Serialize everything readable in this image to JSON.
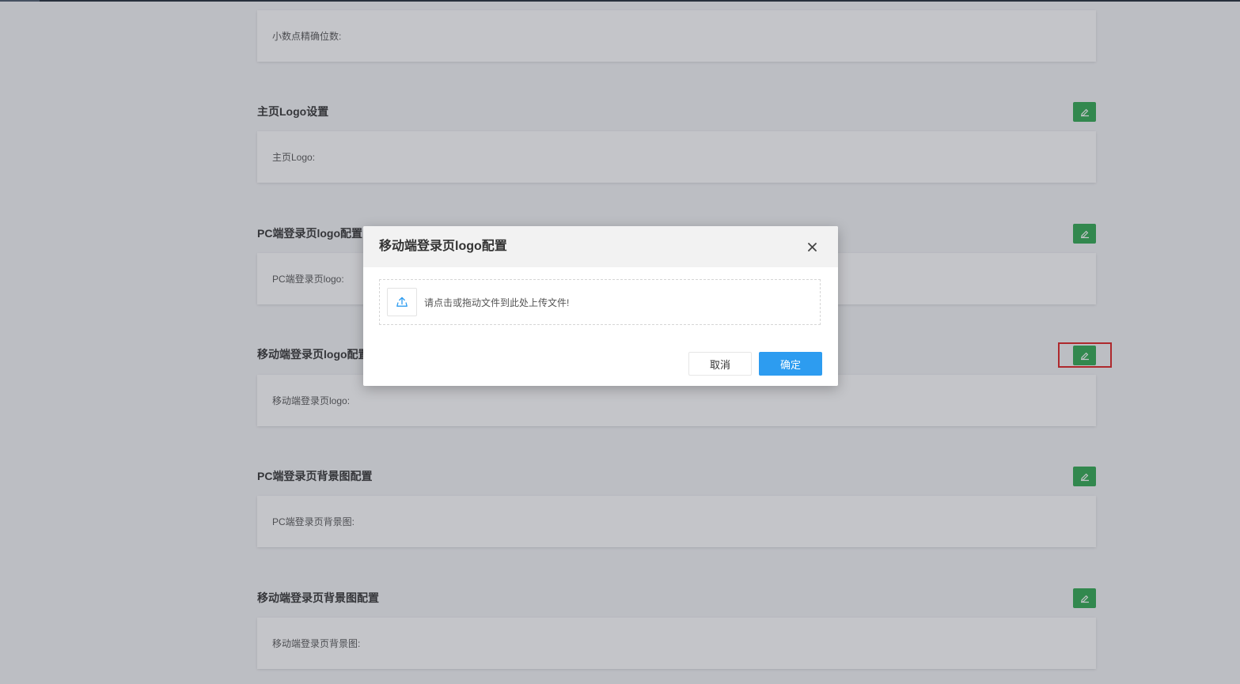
{
  "sections": [
    {
      "title": "",
      "field_label": "小数点精确位数:"
    },
    {
      "title": "主页Logo设置",
      "field_label": "主页Logo:"
    },
    {
      "title": "PC端登录页logo配置",
      "field_label": "PC端登录页logo:"
    },
    {
      "title": "移动端登录页logo配置",
      "field_label": "移动端登录页logo:"
    },
    {
      "title": "PC端登录页背景图配置",
      "field_label": "PC端登录页背景图:"
    },
    {
      "title": "移动端登录页背景图配置",
      "field_label": "移动端登录页背景图:"
    }
  ],
  "edit_icon": "edit-icon",
  "colors": {
    "edit_button": "#2ea84f",
    "primary_button": "#2d9cf0",
    "highlight": "#e02020"
  },
  "modal": {
    "title": "移动端登录页logo配置",
    "close_icon": "close-icon",
    "upload_icon": "upload-icon",
    "dropzone_text": "请点击或拖动文件到此处上传文件!",
    "cancel_label": "取消",
    "ok_label": "确定"
  }
}
